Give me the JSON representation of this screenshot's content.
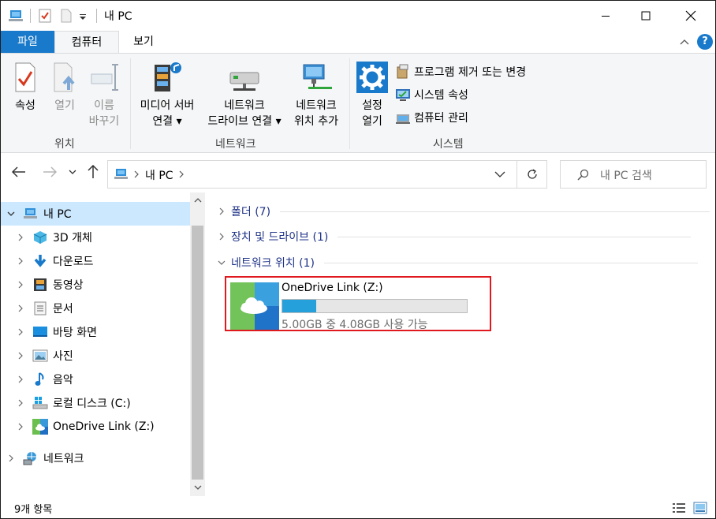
{
  "window": {
    "title": "내 PC"
  },
  "ribbon_tabs": [
    "파일",
    "컴퓨터",
    "보기"
  ],
  "ribbon": {
    "location_group": {
      "label": "위치",
      "properties": "속성",
      "open": "열기",
      "rename_line1": "이름",
      "rename_line2": "바꾸기"
    },
    "network_group": {
      "label": "네트워크",
      "media_server_line1": "미디어 서버",
      "media_server_line2": "연결",
      "map_drive_line1": "네트워크",
      "map_drive_line2": "드라이브 연결",
      "add_location_line1": "네트워크",
      "add_location_line2": "위치 추가"
    },
    "system_group": {
      "label": "시스템",
      "settings_line1": "설정",
      "settings_line2": "열기",
      "uninstall": "프로그램 제거 또는 변경",
      "system_properties": "시스템 속성",
      "manage": "컴퓨터 관리"
    }
  },
  "address": {
    "path": "내 PC",
    "search_placeholder": "내 PC 검색"
  },
  "nav_pane": {
    "items": [
      {
        "label": "내 PC",
        "icon": "computer-icon"
      },
      {
        "label": "3D 개체",
        "icon": "3d-objects-icon"
      },
      {
        "label": "다운로드",
        "icon": "download-icon"
      },
      {
        "label": "동영상",
        "icon": "video-icon"
      },
      {
        "label": "문서",
        "icon": "document-icon"
      },
      {
        "label": "바탕 화면",
        "icon": "desktop-icon"
      },
      {
        "label": "사진",
        "icon": "picture-icon"
      },
      {
        "label": "음악",
        "icon": "music-icon"
      },
      {
        "label": "로컬 디스크 (C:)",
        "icon": "local-disk-icon"
      },
      {
        "label": "OneDrive Link (Z:)",
        "icon": "onedrive-icon"
      },
      {
        "label": "네트워크",
        "icon": "network-icon"
      }
    ]
  },
  "content": {
    "sections": [
      "폴더 (7)",
      "장치 및 드라이브 (1)",
      "네트워크 위치 (1)"
    ],
    "drive": {
      "name": "OneDrive Link (Z:)",
      "free_text": "5.00GB 중 4.08GB 사용 가능",
      "used_fraction": 0.184
    }
  },
  "status": {
    "item_count": "9개 항목"
  },
  "colors": {
    "accent": "#1979ca",
    "selection": "#cce8ff",
    "highlight_border": "#e0191f",
    "progress": "#26a0da"
  }
}
